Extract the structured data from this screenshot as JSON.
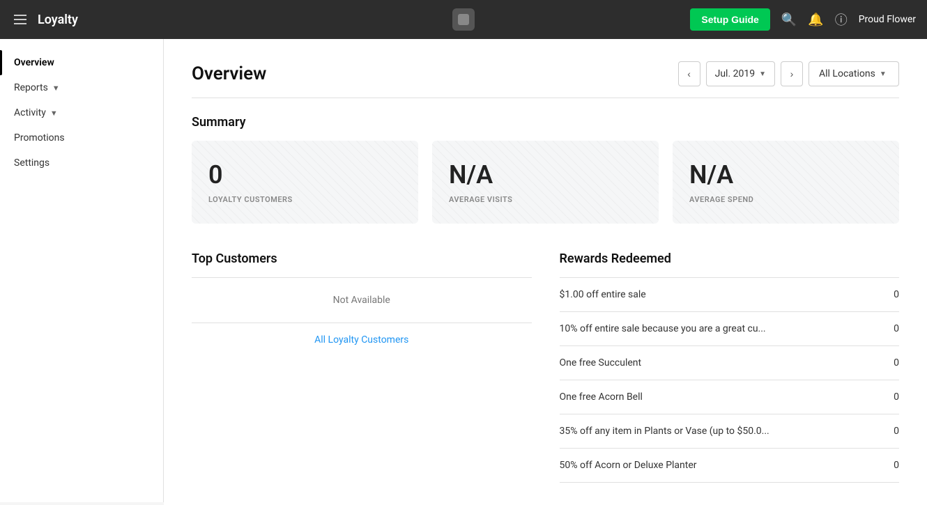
{
  "topnav": {
    "title": "Loyalty",
    "setup_guide_label": "Setup Guide",
    "user_name": "Proud Flower"
  },
  "sidebar": {
    "items": [
      {
        "id": "overview",
        "label": "Overview",
        "active": true,
        "has_chevron": false
      },
      {
        "id": "reports",
        "label": "Reports",
        "active": false,
        "has_chevron": true
      },
      {
        "id": "activity",
        "label": "Activity",
        "active": false,
        "has_chevron": true
      },
      {
        "id": "promotions",
        "label": "Promotions",
        "active": false,
        "has_chevron": false
      },
      {
        "id": "settings",
        "label": "Settings",
        "active": false,
        "has_chevron": false
      }
    ]
  },
  "page": {
    "title": "Overview",
    "date": "Jul. 2019",
    "location": "All Locations"
  },
  "summary": {
    "title": "Summary",
    "cards": [
      {
        "value": "0",
        "label": "LOYALTY CUSTOMERS"
      },
      {
        "value": "N/A",
        "label": "AVERAGE VISITS"
      },
      {
        "value": "N/A",
        "label": "AVERAGE SPEND"
      }
    ]
  },
  "top_customers": {
    "title": "Top Customers",
    "not_available_text": "Not Available",
    "all_link_label": "All Loyalty Customers"
  },
  "rewards_redeemed": {
    "title": "Rewards Redeemed",
    "items": [
      {
        "label": "$1.00 off entire sale",
        "count": "0"
      },
      {
        "label": "10% off entire sale because you are a great cu...",
        "count": "0"
      },
      {
        "label": "One free Succulent",
        "count": "0"
      },
      {
        "label": "One free Acorn Bell",
        "count": "0"
      },
      {
        "label": "35% off any item in Plants or Vase (up to $50.0...",
        "count": "0"
      },
      {
        "label": "50% off Acorn or Deluxe Planter",
        "count": "0"
      }
    ]
  }
}
